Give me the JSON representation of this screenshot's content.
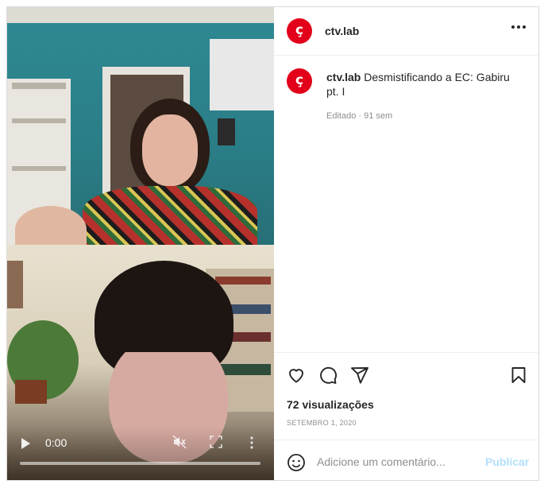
{
  "post": {
    "username": "ctv.lab",
    "caption_text": "Desmistificando a EC: Gabiru pt. I",
    "edited_label": "Editado · 91 sem",
    "views": "72 visualizações",
    "date": "SETEMBRO 1, 2020"
  },
  "video": {
    "time": "0:00",
    "progress": 0
  },
  "comment": {
    "placeholder": "Adicione um comentário...",
    "publish_label": "Publicar"
  },
  "colors": {
    "brand": "#e2001a",
    "publish_disabled": "#b2dffc",
    "border": "#dbdbdb"
  },
  "icons": [
    "like-icon",
    "comment-icon",
    "share-icon",
    "save-icon",
    "emoji-icon",
    "more-options-icon",
    "play-icon",
    "mute-icon",
    "fullscreen-icon",
    "more-vert-icon"
  ]
}
